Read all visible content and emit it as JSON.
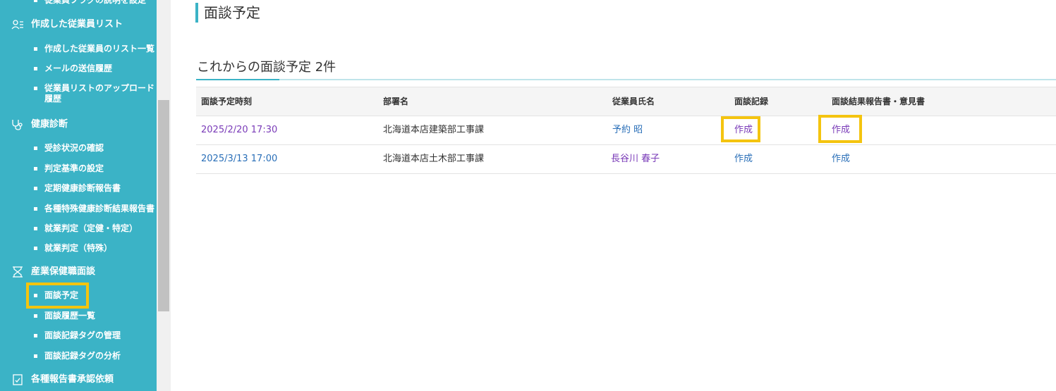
{
  "sidebar": {
    "cut_item": "従業員フラグの説明を設定",
    "sections": [
      {
        "label": "作成した従業員リスト",
        "icon": "user-list-icon",
        "items": [
          "作成した従業員のリスト一覧",
          "メールの送信履歴",
          "従業員リストのアップロード",
          "履歴"
        ]
      },
      {
        "label": "健康診断",
        "icon": "stethoscope-icon",
        "items": [
          "受診状況の確認",
          "判定基準の設定",
          "定期健康診断報告書",
          "各種特殊健康診断結果報告書",
          "就業判定（定健・特定）",
          "就業判定（特殊）"
        ]
      },
      {
        "label": "産業保健職面談",
        "icon": "hourglass-icon",
        "items": [
          "面談予定",
          "面談履歴一覧",
          "面談記録タグの管理",
          "面談記録タグの分析"
        ]
      },
      {
        "label": "各種報告書承認依頼",
        "icon": "document-check-icon",
        "items": []
      }
    ]
  },
  "page": {
    "title": "面談予定",
    "section_heading": "これからの面談予定 2件"
  },
  "table": {
    "headers": [
      "面談予定時刻",
      "部署名",
      "従業員氏名",
      "面談記録",
      "面談結果報告書・意見書"
    ],
    "rows": [
      {
        "time": "2025/2/20 17:30",
        "dept": "北海道本店建築部工事課",
        "name": "予約 昭",
        "record": "作成",
        "report": "作成"
      },
      {
        "time": "2025/3/13 17:00",
        "dept": "北海道本店土木部工事課",
        "name": "長谷川 春子",
        "record": "作成",
        "report": "作成"
      }
    ]
  },
  "colors": {
    "sidebar_bg": "#3bb3c6",
    "highlight": "#f4c40f",
    "link": "#2a6fb8",
    "visited_link": "#7a3bb8"
  }
}
